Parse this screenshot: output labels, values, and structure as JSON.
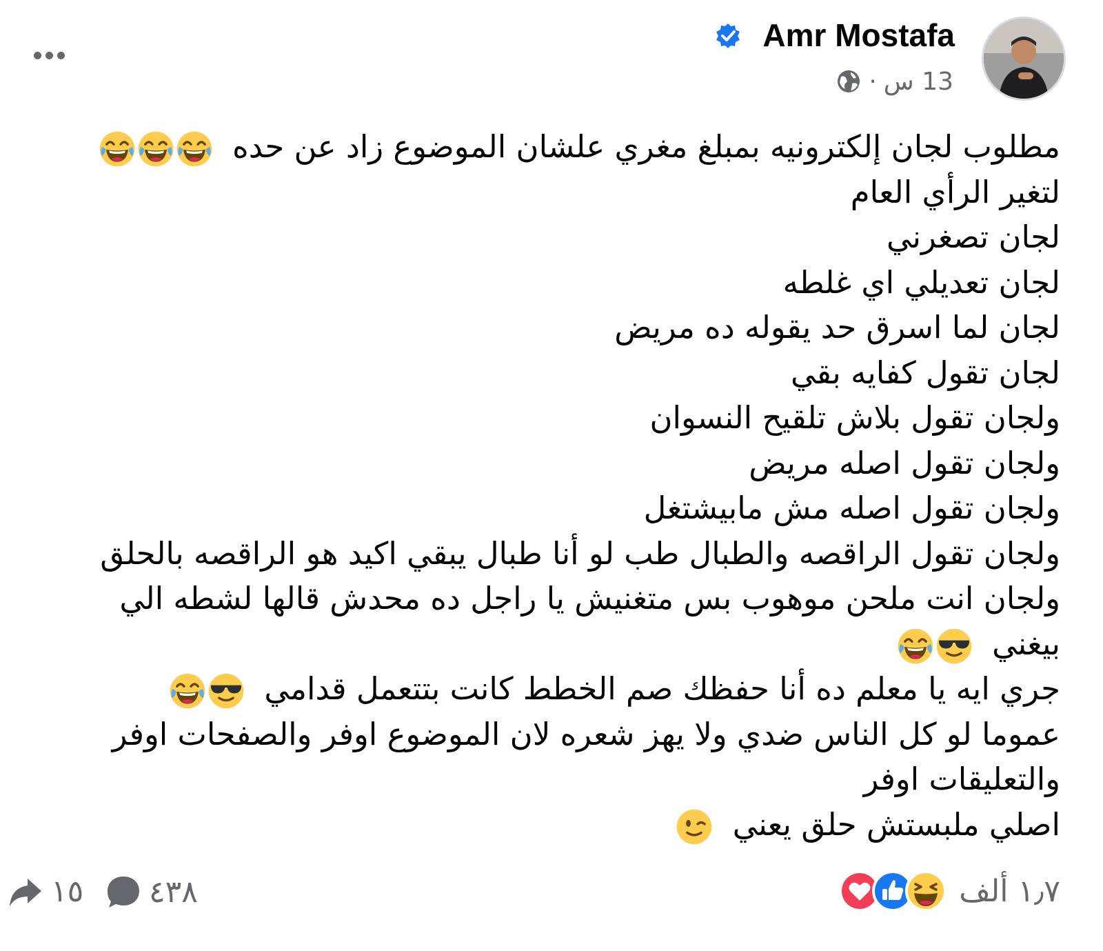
{
  "post": {
    "author": "Amr Mostafa",
    "time": "13 س",
    "separator": "·",
    "lines": [
      "مطلوب لجان إلكترونيه بمبلغ مغري علشان الموضوع زاد عن حده",
      "لتغير الرأي العام",
      "لجان تصغرني",
      "لجان تعديلي اي غلطه",
      "لجان لما اسرق حد  يقوله ده مريض",
      "لجان تقول كفايه بقي",
      "ولجان تقول بلاش تلقيح النسوان",
      "ولجان تقول اصله مريض",
      "ولجان تقول اصله مش مابيشتغل",
      "ولجان تقول الراقصه والطبال  طب لو أنا طبال يبقي اكيد هو الراقصه بالحلق",
      "ولجان انت ملحن موهوب بس متغنيش يا راجل ده محدش قالها لشطه الي",
      "بيغني",
      "جري ايه يا معلم ده أنا حفظك صم الخطط كانت بتتعمل قدامي",
      "عموما لو كل الناس ضدي ولا يهز شعره لان الموضوع اوفر والصفحات اوفر",
      "والتعليقات اوفر",
      "اصلي ملبستش حلق يعني"
    ]
  },
  "stats": {
    "reactions": "١٫٧ ألف",
    "comments": "٤٣٨",
    "shares": "١٥"
  },
  "icons": {
    "more": "more-options-icon",
    "verified": "verified-badge-icon",
    "audience": "globe-icon",
    "laugh": "face-with-tears-of-joy-icon",
    "cool": "smiling-face-with-sunglasses-icon",
    "wink": "winking-face-icon",
    "comment": "comment-bubble-icon",
    "share": "share-arrow-icon",
    "reaction_like": "like-reaction-icon",
    "reaction_love": "love-reaction-icon",
    "reaction_haha": "haha-reaction-icon"
  },
  "colors": {
    "verified_blue": "#1877f2",
    "secondary_text": "#65676b",
    "love_red": "#f33e58",
    "emoji_yellow": "#ffcc4d"
  }
}
